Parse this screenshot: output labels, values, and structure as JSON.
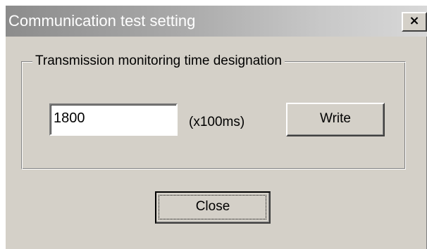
{
  "window": {
    "title": "Communication test setting",
    "close_glyph": "×"
  },
  "group": {
    "legend": "Transmission monitoring time designation",
    "time_input": {
      "value": "1800"
    },
    "unit_label": "(x100ms)",
    "write_label": "Write"
  },
  "footer": {
    "close_label": "Close"
  },
  "colors": {
    "dialog_face": "#d4d0c8",
    "title_gradient_start": "#8c8c8c",
    "title_gradient_end": "#d8d8d8",
    "title_text": "#ffffff"
  },
  "icons": {
    "title_close": "close-icon"
  }
}
